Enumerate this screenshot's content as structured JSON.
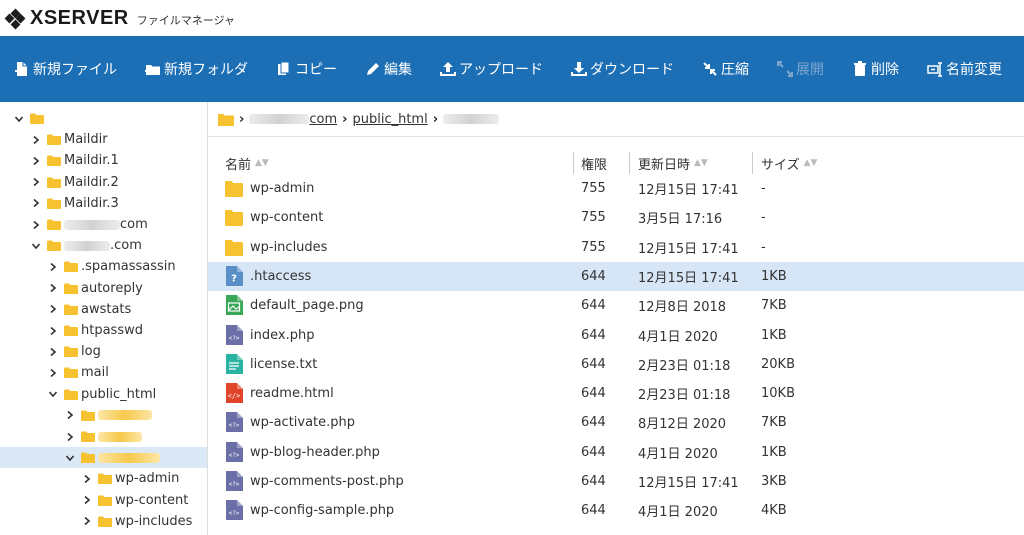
{
  "header": {
    "brand": "XSERVER",
    "app_name": "ファイルマネージャ"
  },
  "toolbar": {
    "buttons": [
      {
        "label": "新規ファイル",
        "icon": "new-file-icon",
        "enabled": true
      },
      {
        "label": "新規フォルダ",
        "icon": "new-folder-icon",
        "enabled": true
      },
      {
        "label": "コピー",
        "icon": "copy-icon",
        "enabled": true
      },
      {
        "label": "編集",
        "icon": "pencil-icon",
        "enabled": true
      },
      {
        "label": "アップロード",
        "icon": "upload-icon",
        "enabled": true
      },
      {
        "label": "ダウンロード",
        "icon": "download-icon",
        "enabled": true
      },
      {
        "label": "圧縮",
        "icon": "compress-icon",
        "enabled": true
      },
      {
        "label": "展開",
        "icon": "expand-icon",
        "enabled": false
      },
      {
        "label": "削除",
        "icon": "trash-icon",
        "enabled": true
      },
      {
        "label": "名前変更",
        "icon": "rename-icon",
        "enabled": true
      }
    ]
  },
  "sidebar": {
    "items": [
      {
        "label": "",
        "depth": 0,
        "open": true,
        "blur_width": 0
      },
      {
        "label": "Maildir",
        "depth": 1,
        "open": false,
        "blur_width": 0
      },
      {
        "label": "Maildir.1",
        "depth": 1,
        "open": false,
        "blur_width": 0
      },
      {
        "label": "Maildir.2",
        "depth": 1,
        "open": false,
        "blur_width": 0
      },
      {
        "label": "Maildir.3",
        "depth": 1,
        "open": false,
        "blur_width": 0
      },
      {
        "label": "com",
        "depth": 1,
        "open": false,
        "blur_width": 56
      },
      {
        "label": ".com",
        "depth": 1,
        "open": true,
        "blur_width": 46
      },
      {
        "label": ".spamassassin",
        "depth": 2,
        "open": false,
        "blur_width": 0
      },
      {
        "label": "autoreply",
        "depth": 2,
        "open": false,
        "blur_width": 0
      },
      {
        "label": "awstats",
        "depth": 2,
        "open": false,
        "blur_width": 0
      },
      {
        "label": "htpasswd",
        "depth": 2,
        "open": false,
        "blur_width": 0
      },
      {
        "label": "log",
        "depth": 2,
        "open": false,
        "blur_width": 0
      },
      {
        "label": "mail",
        "depth": 2,
        "open": false,
        "blur_width": 0
      },
      {
        "label": "public_html",
        "depth": 2,
        "open": true,
        "blur_width": 0
      },
      {
        "label": "",
        "depth": 3,
        "open": false,
        "blur_width": 54
      },
      {
        "label": "",
        "depth": 3,
        "open": false,
        "blur_width": 44
      },
      {
        "label": "",
        "depth": 3,
        "open": true,
        "blur_width": 62,
        "selected": true
      },
      {
        "label": "wp-admin",
        "depth": 4,
        "open": false,
        "blur_width": 0
      },
      {
        "label": "wp-content",
        "depth": 4,
        "open": false,
        "blur_width": 0
      },
      {
        "label": "wp-includes",
        "depth": 4,
        "open": false,
        "blur_width": 0
      }
    ]
  },
  "breadcrumb": {
    "items": [
      {
        "label": "com",
        "blurred_prefix": true
      },
      {
        "label": "public_html",
        "blurred_prefix": false
      },
      {
        "label": "",
        "blurred_prefix": true
      }
    ]
  },
  "table": {
    "columns": [
      "名前",
      "権限",
      "更新日時",
      "サイズ"
    ],
    "rows": [
      {
        "name": "wp-admin",
        "perm": "755",
        "date": "12月15日 17:41",
        "size": "-",
        "type": "folder"
      },
      {
        "name": "wp-content",
        "perm": "755",
        "date": "3月5日 17:16",
        "size": "-",
        "type": "folder"
      },
      {
        "name": "wp-includes",
        "perm": "755",
        "date": "12月15日 17:41",
        "size": "-",
        "type": "folder"
      },
      {
        "name": ".htaccess",
        "perm": "644",
        "date": "12月15日 17:41",
        "size": "1KB",
        "type": "unknown",
        "selected": true
      },
      {
        "name": "default_page.png",
        "perm": "644",
        "date": "12月8日 2018",
        "size": "7KB",
        "type": "image"
      },
      {
        "name": "index.php",
        "perm": "644",
        "date": "4月1日 2020",
        "size": "1KB",
        "type": "php"
      },
      {
        "name": "license.txt",
        "perm": "644",
        "date": "2月23日 01:18",
        "size": "20KB",
        "type": "text"
      },
      {
        "name": "readme.html",
        "perm": "644",
        "date": "2月23日 01:18",
        "size": "10KB",
        "type": "html"
      },
      {
        "name": "wp-activate.php",
        "perm": "644",
        "date": "8月12日 2020",
        "size": "7KB",
        "type": "php"
      },
      {
        "name": "wp-blog-header.php",
        "perm": "644",
        "date": "4月1日 2020",
        "size": "1KB",
        "type": "php"
      },
      {
        "name": "wp-comments-post.php",
        "perm": "644",
        "date": "12月15日 17:41",
        "size": "3KB",
        "type": "php"
      },
      {
        "name": "wp-config-sample.php",
        "perm": "644",
        "date": "4月1日 2020",
        "size": "4KB",
        "type": "php"
      }
    ]
  },
  "colors": {
    "toolbar": "#1c6eb5",
    "folder": "#f6c22f",
    "selected_row": "#d6e6f6",
    "php": "#6a6fa8",
    "text": "#2ab3a0",
    "html": "#e0442b",
    "image": "#3aa757",
    "unknown": "#5a8fc6"
  }
}
